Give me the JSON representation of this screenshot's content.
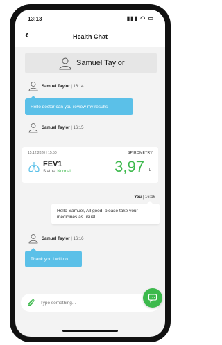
{
  "status_bar": {
    "time": "13:13",
    "icons": [
      "signal-icon",
      "wifi-icon",
      "battery-icon"
    ]
  },
  "nav": {
    "title": "Health Chat",
    "back_icon": "chevron-left-icon"
  },
  "contact": {
    "name": "Samuel Taylor"
  },
  "messages": [
    {
      "sender": "Samuel Taylor",
      "time": "16:14",
      "text": "Hello doctor can you review my results"
    },
    {
      "sender": "Samuel Taylor",
      "time": "16:15",
      "spirometry": {
        "date": "15.12.2020 | 15:50",
        "type": "SPIROMETRY",
        "metric": "FEV1",
        "status_label": "Status:",
        "status": "Normal",
        "value": "3,97",
        "unit": "L"
      }
    },
    {
      "sender": "You",
      "time": "16:16",
      "text": "Hello Samuel, All good, please take your medicines as usual."
    },
    {
      "sender": "Samuel Taylor",
      "time": "16:16",
      "text": "Thank you I will do"
    }
  ],
  "composer": {
    "placeholder": "Type something..."
  },
  "colors": {
    "accent_blue": "#5bc0e8",
    "accent_green": "#3cb94c"
  }
}
